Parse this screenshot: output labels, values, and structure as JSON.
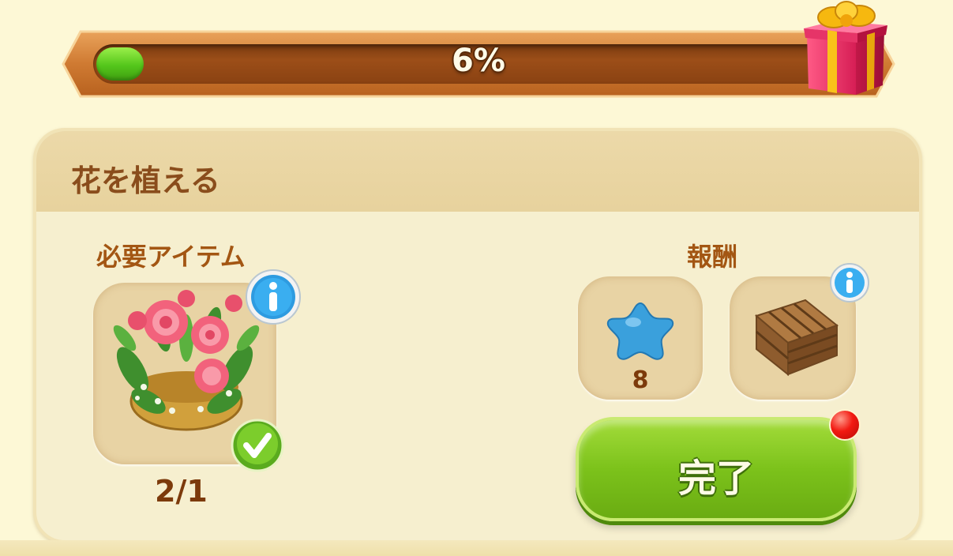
{
  "progress": {
    "percent_label": "6%",
    "fraction": 0.06,
    "fill_color": "#54c61b"
  },
  "reward_chest": {
    "icon": "gift-box-icon"
  },
  "task": {
    "title": "花を植える",
    "required": {
      "label": "必要アイテム",
      "item_icon": "flower-pot-icon",
      "count": "2/1",
      "status_icon": "check-icon"
    },
    "rewards": {
      "label": "報酬",
      "items": [
        {
          "icon": "blue-star-icon",
          "amount": "8"
        },
        {
          "icon": "wooden-crate-icon",
          "amount": ""
        }
      ]
    },
    "complete_button": {
      "label": "完了",
      "notification_icon": "red-dot-icon"
    }
  },
  "colors": {
    "background": "#fdf8d6",
    "panel": "#f6efcf",
    "title_text": "#8a4d1c",
    "button_green": "#7cc21b"
  }
}
